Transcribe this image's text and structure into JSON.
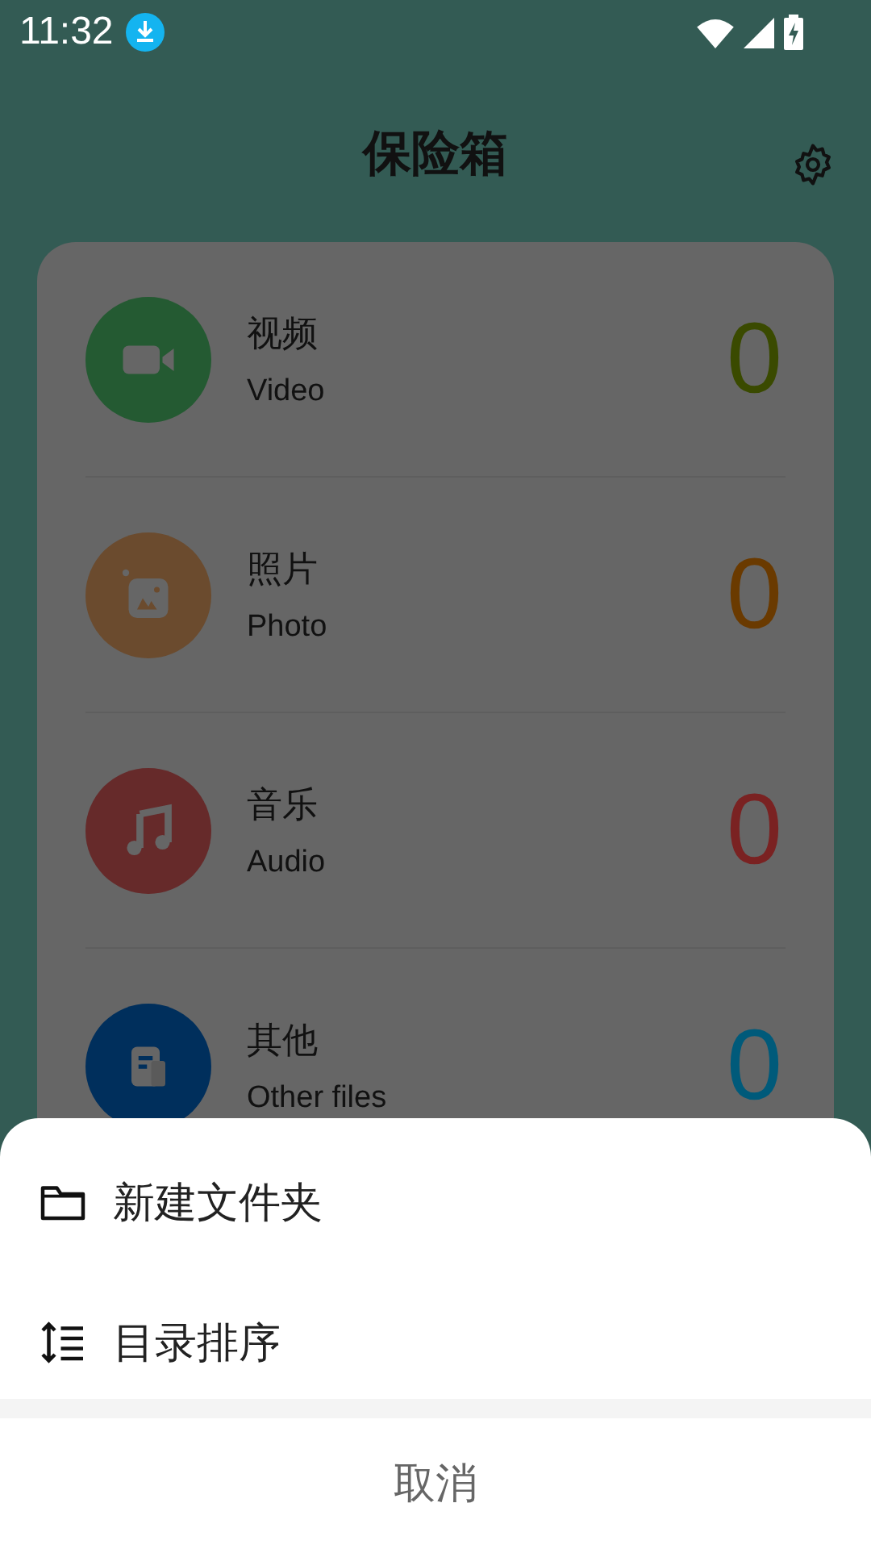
{
  "status_bar": {
    "time": "11:32"
  },
  "header": {
    "title": "保险箱"
  },
  "categories": [
    {
      "kind": "video",
      "title": "视频",
      "subtitle": "Video",
      "count": "0",
      "color": "#245a32"
    },
    {
      "kind": "photo",
      "title": "照片",
      "subtitle": "Photo",
      "count": "0",
      "color": "#6b4b2e"
    },
    {
      "kind": "audio",
      "title": "音乐",
      "subtitle": "Audio",
      "count": "0",
      "color": "#662a2a"
    },
    {
      "kind": "other",
      "title": "其他",
      "subtitle": "Other files",
      "count": "0",
      "color": "#002f5c"
    }
  ],
  "sheet": {
    "items": [
      {
        "kind": "folder",
        "label": "新建文件夹"
      },
      {
        "kind": "sort",
        "label": "目录排序"
      }
    ],
    "cancel": "取消"
  }
}
